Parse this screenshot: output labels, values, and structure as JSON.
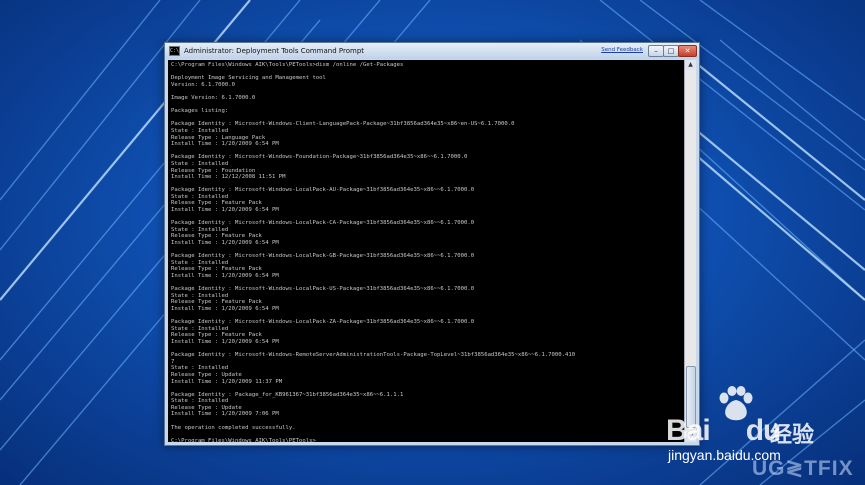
{
  "window": {
    "title": "Administrator: Deployment Tools Command Prompt",
    "icon_label": "C:\\",
    "send_feedback": "Send Feedback",
    "minimize_icon": "minimize-icon",
    "maximize_icon": "maximize-icon",
    "close_icon": "close-icon"
  },
  "console": {
    "lines": [
      "C:\\Program Files\\Windows AIK\\Tools\\PETools>dism /online /Get-Packages",
      "",
      "Deployment Image Servicing and Management tool",
      "Version: 6.1.7000.0",
      "",
      "Image Version: 6.1.7000.0",
      "",
      "Packages listing:",
      "",
      "Package Identity : Microsoft-Windows-Client-LanguagePack-Package~31bf3856ad364e35~x86~en-US~6.1.7000.0",
      "State : Installed",
      "Release Type : Language Pack",
      "Install Time : 1/20/2009 6:54 PM",
      "",
      "Package Identity : Microsoft-Windows-Foundation-Package~31bf3856ad364e35~x86~~6.1.7000.0",
      "State : Installed",
      "Release Type : Foundation",
      "Install Time : 12/12/2008 11:51 PM",
      "",
      "Package Identity : Microsoft-Windows-LocalPack-AU-Package~31bf3856ad364e35~x86~~6.1.7000.0",
      "State : Installed",
      "Release Type : Feature Pack",
      "Install Time : 1/20/2009 6:54 PM",
      "",
      "Package Identity : Microsoft-Windows-LocalPack-CA-Package~31bf3856ad364e35~x86~~6.1.7000.0",
      "State : Installed",
      "Release Type : Feature Pack",
      "Install Time : 1/20/2009 6:54 PM",
      "",
      "Package Identity : Microsoft-Windows-LocalPack-GB-Package~31bf3856ad364e35~x86~~6.1.7000.0",
      "State : Installed",
      "Release Type : Feature Pack",
      "Install Time : 1/20/2009 6:54 PM",
      "",
      "Package Identity : Microsoft-Windows-LocalPack-US-Package~31bf3856ad364e35~x86~~6.1.7000.0",
      "State : Installed",
      "Release Type : Feature Pack",
      "Install Time : 1/20/2009 6:54 PM",
      "",
      "Package Identity : Microsoft-Windows-LocalPack-ZA-Package~31bf3856ad364e35~x86~~6.1.7000.0",
      "State : Installed",
      "Release Type : Feature Pack",
      "Install Time : 1/20/2009 6:54 PM",
      "",
      "Package Identity : Microsoft-Windows-RemoteServerAdministrationTools-Package-TopLevel~31bf3856ad364e35~x86~~6.1.7000.410",
      "7",
      "State : Installed",
      "Release Type : Update",
      "Install Time : 1/20/2009 11:37 PM",
      "",
      "Package Identity : Package_for_KB961367~31bf3856ad364e35~x86~~6.1.1.1",
      "State : Installed",
      "Release Type : Update",
      "Install Time : 1/20/2009 7:06 PM",
      "",
      "The operation completed successfully.",
      "",
      "C:\\Program Files\\Windows AIK\\Tools\\PETools>_"
    ]
  },
  "scrollbar": {
    "up_arrow": "▲",
    "down_arrow": "▼"
  },
  "watermark": {
    "baidu": "Bai",
    "baidu_du": "du",
    "jingyan_cn": "经验",
    "url": "jingyan.baidu.com",
    "ugetfix": "UG≷TFIX"
  }
}
